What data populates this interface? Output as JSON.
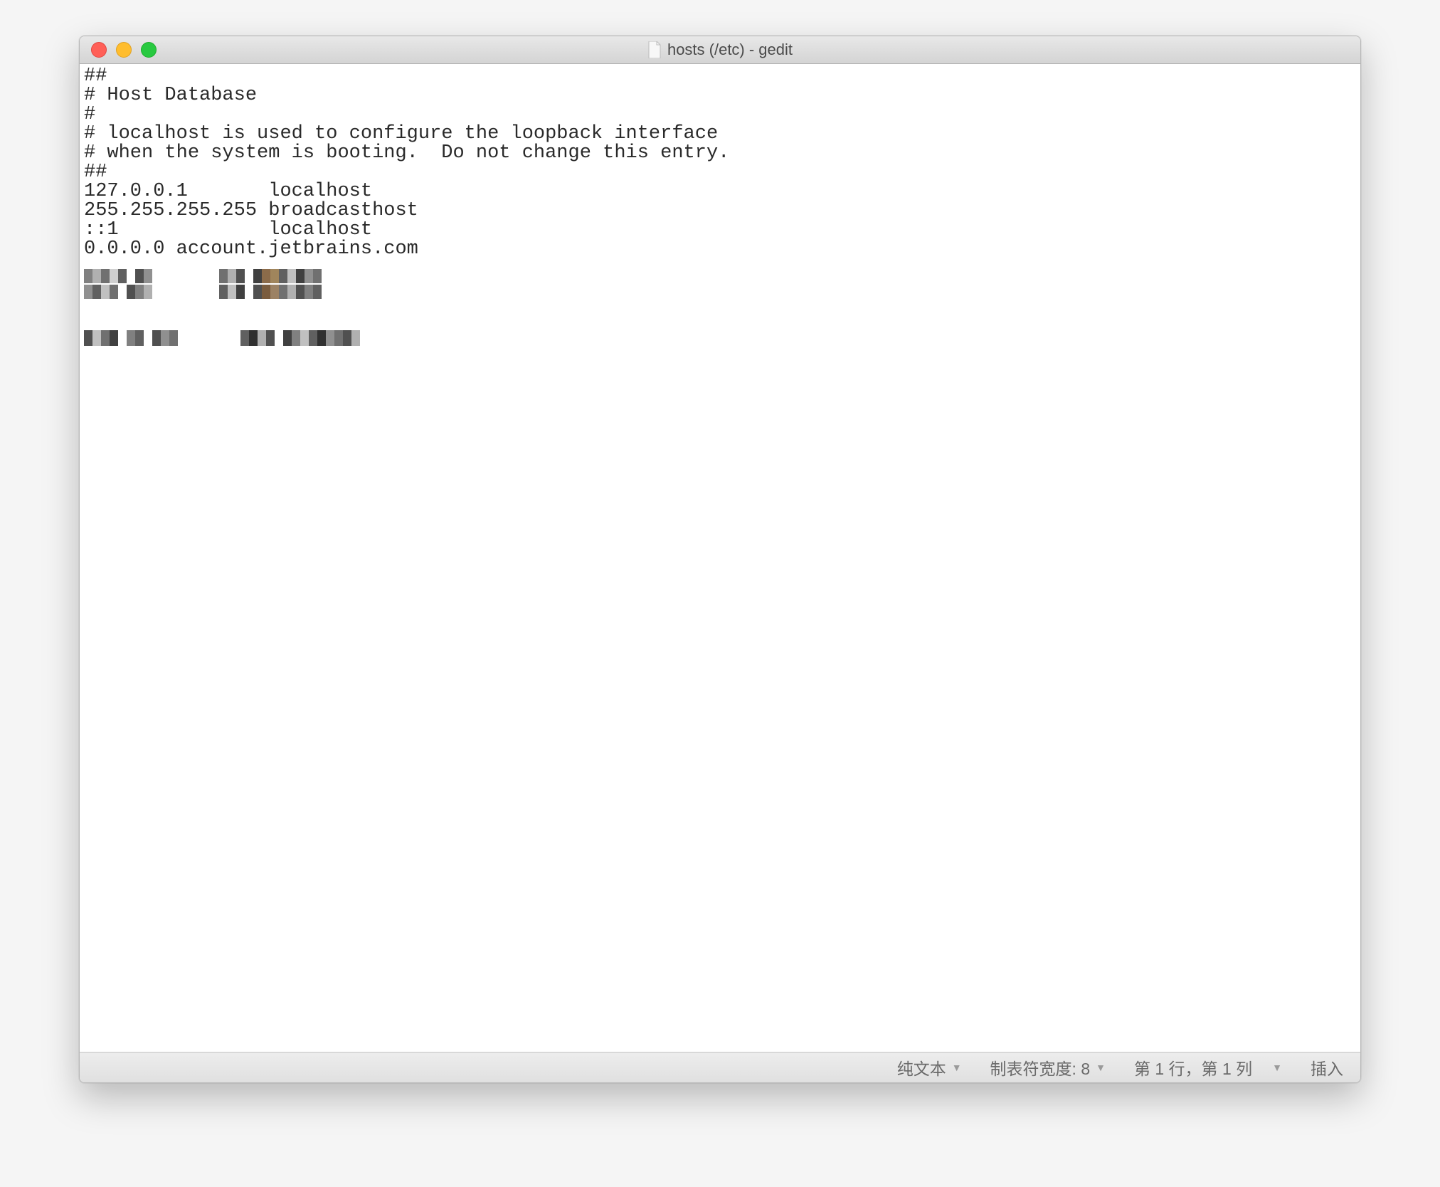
{
  "window": {
    "title": "hosts (/etc) - gedit"
  },
  "editor": {
    "content": "##\n# Host Database\n#\n# localhost is used to configure the loopback interface\n# when the system is booting.  Do not change this entry.\n##\n127.0.0.1       localhost\n255.255.255.255 broadcasthost\n::1             localhost\n0.0.0.0 account.jetbrains.com"
  },
  "statusbar": {
    "syntax_label": "纯文本",
    "tab_width_label": "制表符宽度: 8",
    "position_label": "第 1 行，第 1 列",
    "insert_mode_label": "插入"
  }
}
